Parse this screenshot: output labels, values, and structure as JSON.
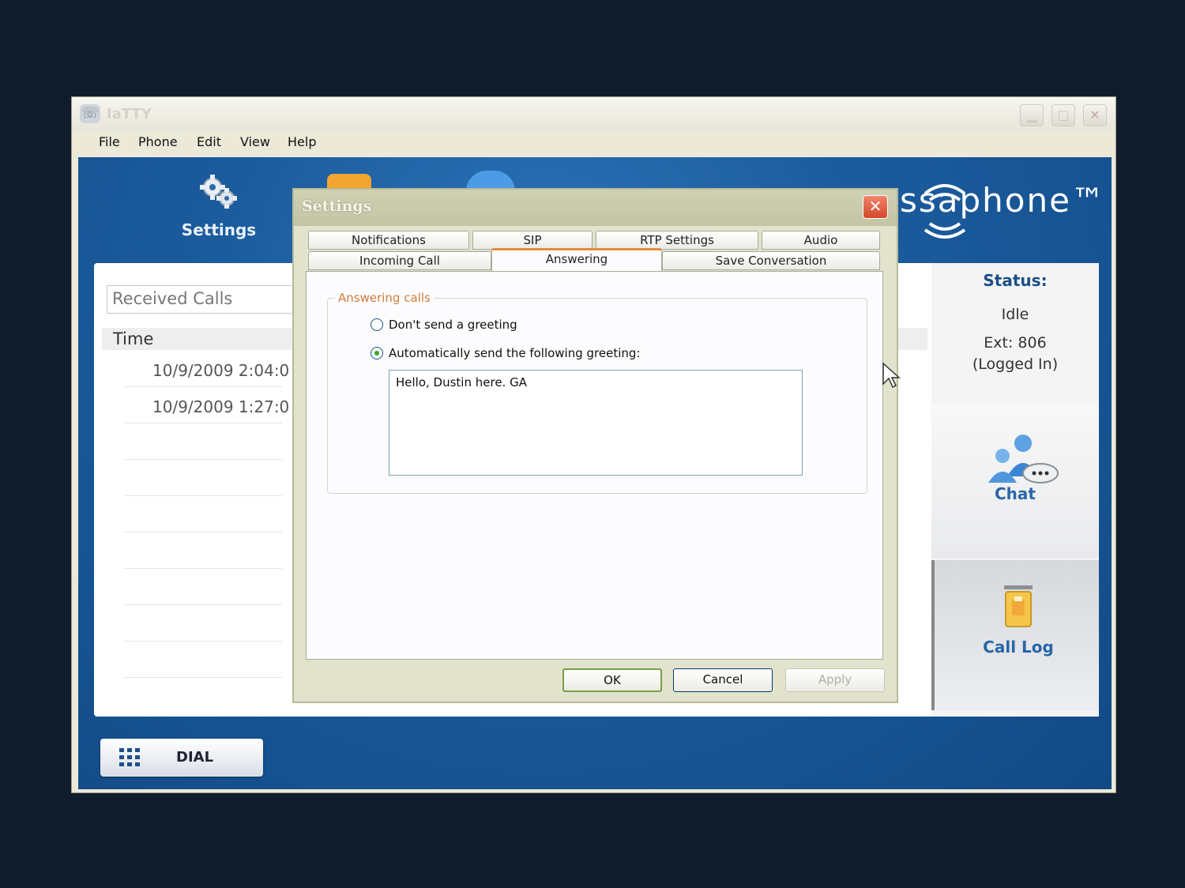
{
  "app": {
    "title": "IaTTY",
    "menu": [
      "File",
      "Phone",
      "Edit",
      "View",
      "Help"
    ],
    "nav_settings_label": "Settings",
    "brand_text": "ssaphone™",
    "calls_view": "Received Calls",
    "time_header": "Time",
    "rows": [
      "10/9/2009 2:04:0",
      "10/9/2009 1:27:0"
    ],
    "status": {
      "title": "Status:",
      "value": "Idle",
      "ext": "Ext:  806",
      "login": "(Logged In)"
    },
    "chat_label": "Chat",
    "calllog_label": "Call Log",
    "dial_label": "DIAL"
  },
  "dialog": {
    "title": "Settings",
    "close_glyph": "✕",
    "tabs_row1": [
      "Notifications",
      "SIP",
      "RTP Settings",
      "Audio"
    ],
    "tabs_row2": [
      "Incoming Call",
      "Answering",
      "Save Conversation"
    ],
    "group_title": "Answering calls",
    "option_no_greeting": "Don't send a greeting",
    "option_auto_greeting": "Automatically send the following greeting:",
    "greeting_text": "Hello, Dustin here. GA",
    "buttons": {
      "ok": "OK",
      "cancel": "Cancel",
      "apply": "Apply"
    }
  },
  "colors": {
    "accent_tab": "#e98a3b",
    "app_blue": "#1b5c9e",
    "brand_label": "#2866a8"
  }
}
